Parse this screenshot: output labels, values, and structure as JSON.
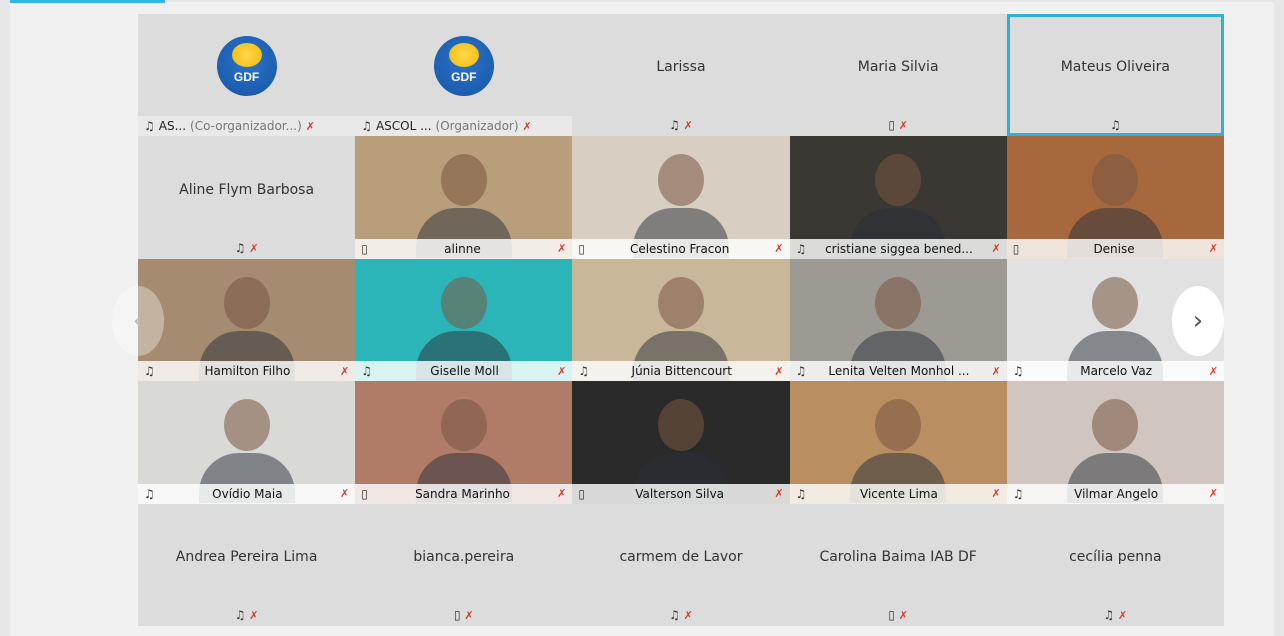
{
  "controls": {
    "prev_label": "‹",
    "next_label": "›"
  },
  "tiles": [
    {
      "kind": "org",
      "name": "AS...",
      "role": "(Co-organizador...)",
      "mic": "muted"
    },
    {
      "kind": "org",
      "name": "ASCOL ...",
      "role": "(Organizador)",
      "mic": "muted"
    },
    {
      "kind": "name",
      "name": "Larissa",
      "device": "headset",
      "mic": "muted"
    },
    {
      "kind": "name",
      "name": "Maria Silvia",
      "device": "phone",
      "mic": "muted"
    },
    {
      "kind": "name",
      "name": "Mateus Oliveira",
      "device": "headset",
      "mic": "on",
      "active": true
    },
    {
      "kind": "name",
      "name": "Aline Flym Barbosa",
      "device": "headset",
      "mic": "muted"
    },
    {
      "kind": "video",
      "name": "alinne",
      "device": "phone",
      "mic": "muted",
      "bg": "#b89e7a"
    },
    {
      "kind": "video",
      "name": "Celestino Fracon",
      "device": "phone",
      "mic": "muted",
      "bg": "#d8cfc2"
    },
    {
      "kind": "video",
      "name": "cristiane siggea bened...",
      "device": "headset",
      "mic": "muted",
      "bg": "#3b3733"
    },
    {
      "kind": "video",
      "name": "Denise",
      "device": "phone",
      "mic": "muted",
      "bg": "#a7683e"
    },
    {
      "kind": "video",
      "name": "Hamilton Filho",
      "device": "headset",
      "mic": "muted",
      "bg": "#a58b6f"
    },
    {
      "kind": "video",
      "name": "Giselle Moll",
      "device": "headset",
      "mic": "muted",
      "bg": "#2cb5b9"
    },
    {
      "kind": "video",
      "name": "Júnia Bittencourt",
      "device": "headset",
      "mic": "muted",
      "bg": "#c9b79a"
    },
    {
      "kind": "video",
      "name": "Lenita Velten Monhol ...",
      "device": "headset",
      "mic": "muted",
      "bg": "#9d9a94"
    },
    {
      "kind": "video",
      "name": "Marcelo Vaz",
      "device": "headset",
      "mic": "muted",
      "bg": "#e1e1e1"
    },
    {
      "kind": "video",
      "name": "Ovídio Maia",
      "device": "headset",
      "mic": "muted",
      "bg": "#d9d9d6"
    },
    {
      "kind": "video",
      "name": "Sandra Marinho",
      "device": "phone",
      "mic": "muted",
      "bg": "#b07c68"
    },
    {
      "kind": "video",
      "name": "Valterson Silva",
      "device": "phone",
      "mic": "muted",
      "bg": "#2a2a2a"
    },
    {
      "kind": "video",
      "name": "Vicente Lima",
      "device": "headset",
      "mic": "muted",
      "bg": "#b98f61"
    },
    {
      "kind": "video",
      "name": "Vilmar Angelo",
      "device": "headset",
      "mic": "muted",
      "bg": "#d0c6bf"
    },
    {
      "kind": "name",
      "name": "Andrea Pereira Lima",
      "device": "headset",
      "mic": "muted"
    },
    {
      "kind": "name",
      "name": "bianca.pereira",
      "device": "phone",
      "mic": "muted"
    },
    {
      "kind": "name",
      "name": "carmem de Lavor",
      "device": "headset",
      "mic": "muted"
    },
    {
      "kind": "name",
      "name": "Carolina Baima IAB DF",
      "device": "phone",
      "mic": "muted"
    },
    {
      "kind": "name",
      "name": "cecília penna",
      "device": "headset",
      "mic": "muted"
    }
  ],
  "icons": {
    "headset": "headset-icon",
    "phone": "phone-icon",
    "mic_muted": "mic-muted-icon"
  },
  "logo_text": "GDF",
  "colors": {
    "active_border": "#2fb1d6",
    "mute": "#d53b2b",
    "tile_bg": "#dcdcdc"
  }
}
